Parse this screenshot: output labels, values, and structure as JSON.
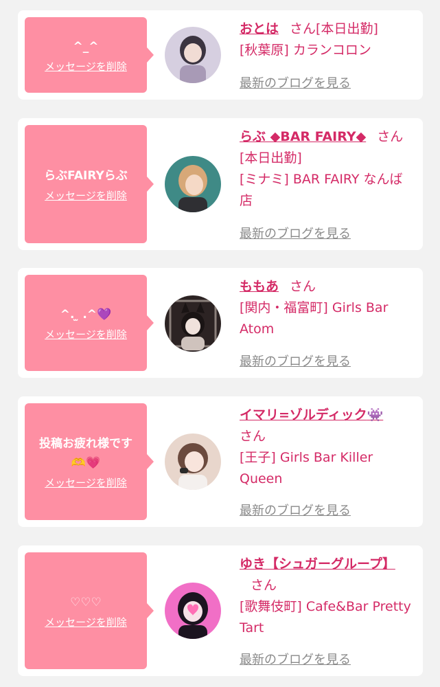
{
  "delete_label": "メッセージを削除",
  "blog_label": "最新のブログを見る",
  "honorific": "さん",
  "cards": [
    {
      "message": "^_^",
      "name": "おとは",
      "status": "[本日出勤]",
      "location": "[秋葉原] カランコロン",
      "avatar_colors": [
        "#3b3440",
        "#a89ab6"
      ]
    },
    {
      "message": "らぶFAIRYらぶ",
      "name": "らぶ ◆BAR FAIRY◆",
      "status": "[本日出勤]",
      "location": "[ミナミ] BAR FAIRY なんば店",
      "avatar_colors": [
        "#d7a878",
        "#3f8a86"
      ]
    },
    {
      "message": "^. ̫ .^",
      "message_emoji": "💜",
      "name": "ももあ",
      "location": "[関内・福富町] Girls Bar Atom",
      "avatar_colors": [
        "#2c2323",
        "#cfc3bd"
      ]
    },
    {
      "message": "投稿お疲れ様です",
      "message_emoji": "🫶💗",
      "name": "イマリ=ゾルディック",
      "name_emoji": "👾",
      "location": "[王子] Girls Bar Killer Queen",
      "avatar_colors": [
        "#e8d6cc",
        "#6b4a3e"
      ]
    },
    {
      "message": "♡♡♡",
      "name": "ゆき【シュガーグループ】",
      "location": "[歌舞伎町] Cafe&Bar Pretty Tart",
      "avatar_colors": [
        "#f16fc6",
        "#1c1420"
      ]
    }
  ]
}
